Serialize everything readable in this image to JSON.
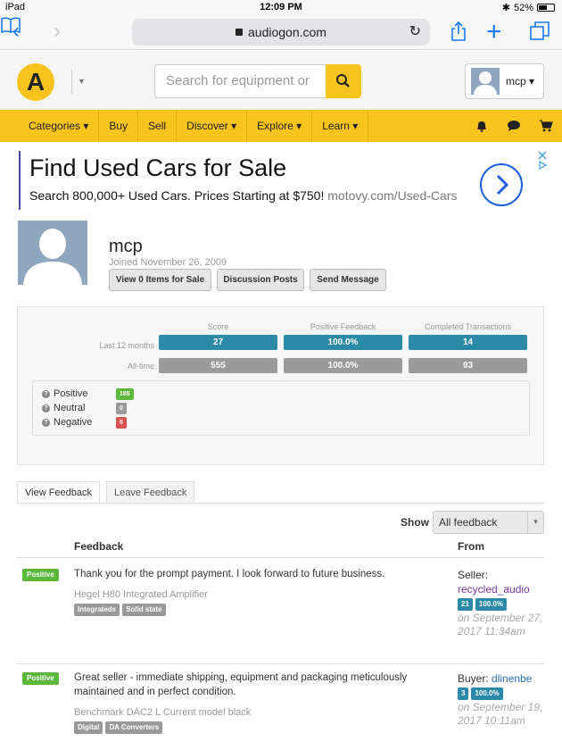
{
  "status_bar": {
    "device": "iPad",
    "time": "12:09 PM",
    "battery": "52%"
  },
  "browser": {
    "url": "audiogon.com"
  },
  "header": {
    "logo_letter": "A",
    "search_placeholder": "Search for equipment or",
    "user_name": "mcp"
  },
  "nav": {
    "items": [
      "Categories ▾",
      "Buy",
      "Sell",
      "Discover ▾",
      "Explore ▾",
      "Learn ▾"
    ]
  },
  "ad": {
    "title": "Find Used Cars for Sale",
    "subtitle": "Search 800,000+ Used Cars. Prices Starting at $750!",
    "domain": "motovy.com/Used-Cars"
  },
  "profile": {
    "name": "mcp",
    "joined": "Joined November 26, 2009",
    "buttons": [
      "View 0 Items for Sale",
      "Discussion Posts",
      "Send Message"
    ]
  },
  "stats": {
    "columns": [
      "Score",
      "Positive Feedback",
      "Completed Transactions"
    ],
    "last12_label": "Last 12 months",
    "alltime_label": "All-time",
    "last12": [
      "27",
      "100.0%",
      "14"
    ],
    "alltime": [
      "555",
      "100.0%",
      "93"
    ],
    "ratings": [
      {
        "label": "Positive",
        "count": "185",
        "color": "#5cb83c"
      },
      {
        "label": "Neutral",
        "count": "0",
        "color": "#9a9a9a"
      },
      {
        "label": "Negative",
        "count": "0",
        "color": "#d9534f"
      }
    ]
  },
  "tabs": {
    "view": "View Feedback",
    "leave": "Leave Feedback"
  },
  "filter": {
    "label": "Show",
    "value": "All feedback"
  },
  "table_headers": {
    "feedback": "Feedback",
    "from": "From"
  },
  "feedback": [
    {
      "badge": "Positive",
      "text": "Thank you for the prompt payment. I look forward to future business.",
      "item": "Hegel H80 Integrated Amplifier",
      "tags": [
        "Integrateds",
        "Solid state"
      ],
      "role": "Seller:",
      "user": "recycled_audio",
      "score": "21",
      "pct": "100.0%",
      "date": "on September 27, 2017 11:34am"
    },
    {
      "badge": "Positive",
      "text": "Great seller - immediate shipping, equipment and packaging meticulously maintained and in perfect condition.",
      "item": "Benchmark DAC2 L Current model black",
      "tags": [
        "Digital",
        "DA Converters"
      ],
      "role": "Buyer:",
      "user": "dlinenbe",
      "score": "3",
      "pct": "100.0%",
      "date": "on September 19, 2017 10:11am"
    }
  ]
}
